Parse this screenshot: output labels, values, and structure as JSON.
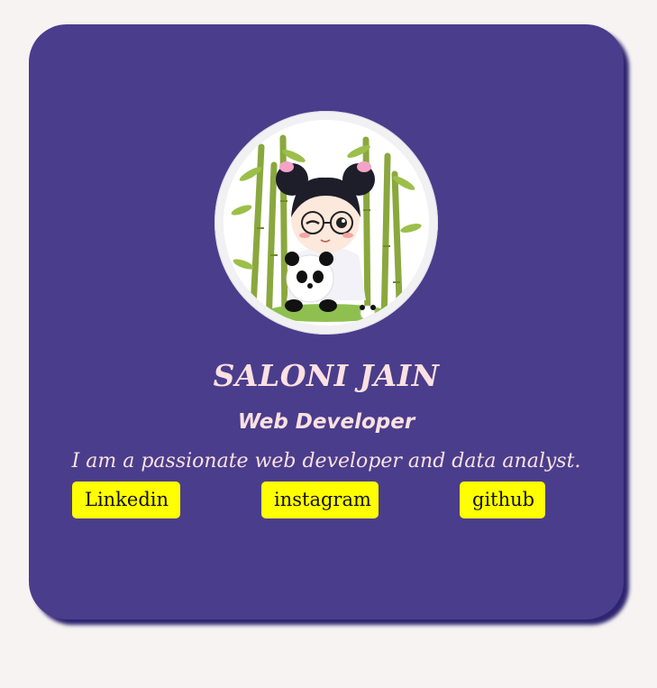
{
  "profile": {
    "name": "SALONI JAIN",
    "role": "Web Developer",
    "bio": "I am a passionate web developer and data analyst.",
    "avatar_icon": "chibi-girl-with-panda-avatar"
  },
  "links": {
    "linkedin": "Linkedin",
    "instagram": "instagram",
    "github": "github"
  },
  "colors": {
    "page_bg": "#f7f3f3",
    "card_bg": "#4a3d8c",
    "card_shadow": "#2e2470",
    "text": "#fbe1e1",
    "button_bg": "#ffff00"
  }
}
